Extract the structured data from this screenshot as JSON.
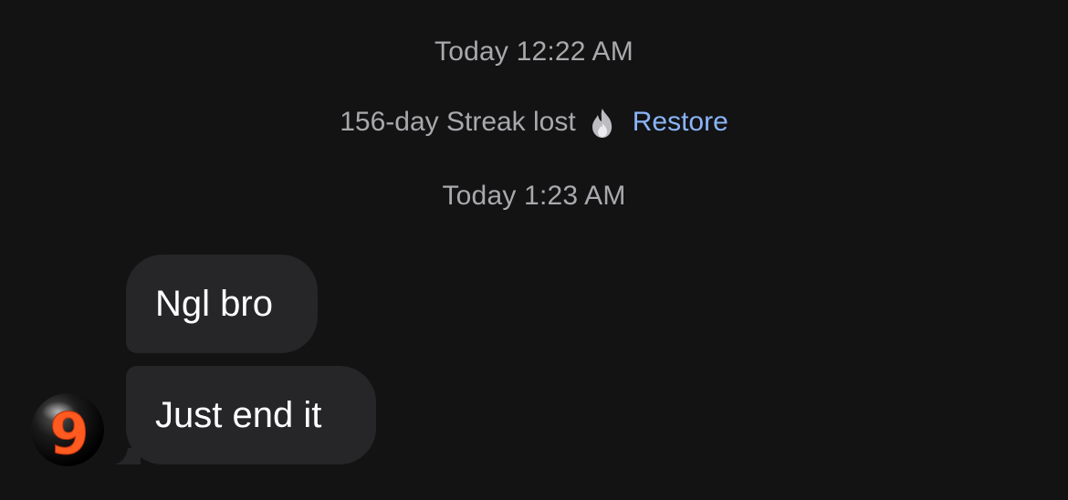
{
  "conversation": {
    "timestamp_1": "Today 12:22 AM",
    "streak": {
      "text": "156-day Streak lost",
      "icon": "fire-icon",
      "action_label": "Restore",
      "action_color": "#8ab4f8"
    },
    "timestamp_2": "Today 1:23 AM",
    "messages": [
      {
        "text": "Ngl bro"
      },
      {
        "text": "Just end it"
      }
    ],
    "sender_avatar": {
      "glyph": "9",
      "accent_color": "#ff5a1f"
    }
  },
  "theme": {
    "background": "#131314",
    "bubble_background": "#262628",
    "meta_text_color": "#a9a9ad"
  }
}
